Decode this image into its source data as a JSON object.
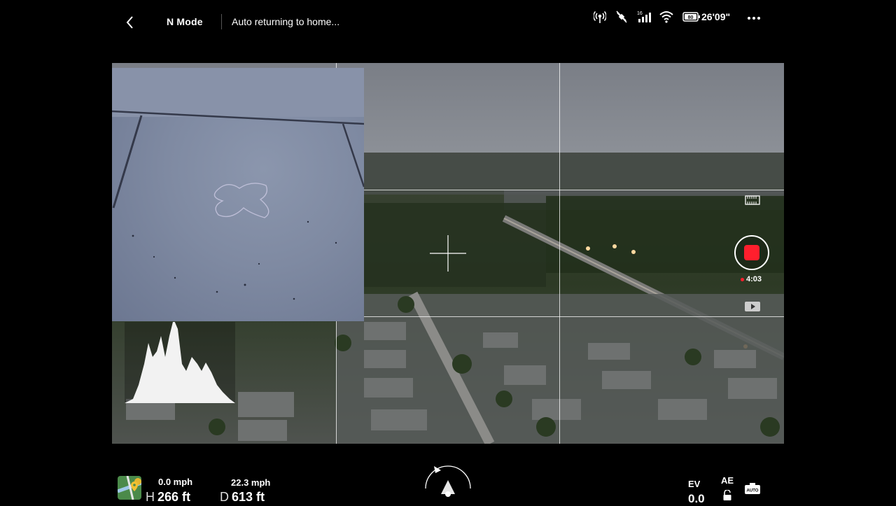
{
  "top_bar": {
    "flight_mode": "N Mode",
    "status_message": "Auto returning to home...",
    "signal_label": "16",
    "battery_percent": "80",
    "flight_time_remaining": "26'09\""
  },
  "recording": {
    "elapsed": "4:03",
    "record_color": "#ff1f2d"
  },
  "telemetry": {
    "vertical_speed": "0.0 mph",
    "horizontal_speed": "22.3 mph",
    "height_letter": "H",
    "height": "266 ft",
    "distance_letter": "D",
    "distance": "613 ft"
  },
  "exposure": {
    "ev_label": "EV",
    "ev_value": "0.0",
    "ae_label": "AE",
    "auto_label": "AUTO"
  },
  "icons": {
    "back": "chevron-left-icon",
    "beacon": "beacon-icon",
    "gps": "satellite-icon",
    "signal": "signal-bars-icon",
    "wifi": "wifi-icon",
    "battery": "battery-icon",
    "more": "more-dots-icon",
    "storage": "sd-card-icon",
    "playback": "playback-icon",
    "map": "map-icon",
    "lock": "lock-icon",
    "auto": "camera-auto-icon"
  }
}
